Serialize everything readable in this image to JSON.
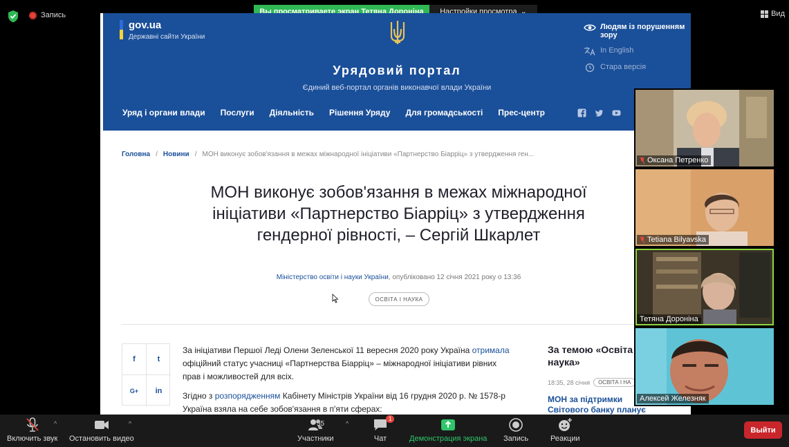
{
  "zoom": {
    "recording_label": "Запись",
    "share_banner": "Вы просматриваете экран Тетяна Дороніна",
    "view_options": "Настройки просмотра",
    "view_button": "Вид"
  },
  "site": {
    "brand_name": "gov.ua",
    "brand_sub": "Державні сайти України",
    "portal_title": "Урядовий портал",
    "portal_sub": "Єдиний веб-портал органів виконавчої влади України",
    "accessibility": [
      "Людям із порушенням зору",
      "In English",
      "Стара версія"
    ],
    "nav": [
      "Уряд і органи влади",
      "Послуги",
      "Діяльність",
      "Рішення Уряду",
      "Для громадськості",
      "Прес-центр"
    ],
    "colors": {
      "header_bg": "#1a4f99",
      "flag_blue": "#2f6bd8",
      "flag_yellow": "#f7d338",
      "trident": "#e8c25c"
    }
  },
  "article": {
    "breadcrumb_home": "Головна",
    "breadcrumb_news": "Новини",
    "breadcrumb_current": "МОН виконує зобов'язання в межах міжнародної ініціативи «Партнерство Біарріц» з утвердження ген...",
    "title": "МОН виконує зобов'язання в межах міжнародної ініціативи «Партнерство Біарріц» з утвердження гендерної рівності, – Сергій Шкарлет",
    "meta_ministry": "Міністерство освіти і науки України",
    "meta_published": ", опубліковано 12 січня 2021 року о 13:36",
    "tag": "ОСВІТА І НАУКА",
    "share": [
      "f",
      "t",
      "G+",
      "in"
    ],
    "p1_a": "За ініціативи Першої Леді Олени Зеленської 11 вересня 2020 року Україна ",
    "p1_link": "отримала",
    "p1_b": " офіційний статус учасниці «Партнерства Біарріц» – міжнародної ініціативи рівних прав і можливостей для всіх.",
    "p2_a": "Згідно з ",
    "p2_link": "розпорядженням",
    "p2_b": " Кабінету Міністрів України від 16 грудня 2020 р. № 1578-р Україна взяла на себе зобов'язання в п'яти сферах:"
  },
  "sidebar": {
    "title": "За темою «Освіта і наука»",
    "date": "18:35, 28 січня",
    "tag": "ОСВІТА І НА",
    "news": "МОН за підтримки Світового банку планує розпочати проект з"
  },
  "participants": [
    {
      "name": "Оксана Петренко",
      "muted": true
    },
    {
      "name": "Tetiana Bilyavska",
      "muted": true
    },
    {
      "name": "Тетяна Дороніна",
      "muted": false
    },
    {
      "name": "Алексей Железняк",
      "muted": false
    }
  ],
  "toolbar": {
    "mute": "Включить звук",
    "video": "Остановить видео",
    "participants": "Участники",
    "participants_count": "55",
    "chat": "Чат",
    "chat_badge": "1",
    "share": "Демонстрация экрана",
    "record": "Запись",
    "reactions": "Реакции",
    "leave": "Выйти"
  }
}
